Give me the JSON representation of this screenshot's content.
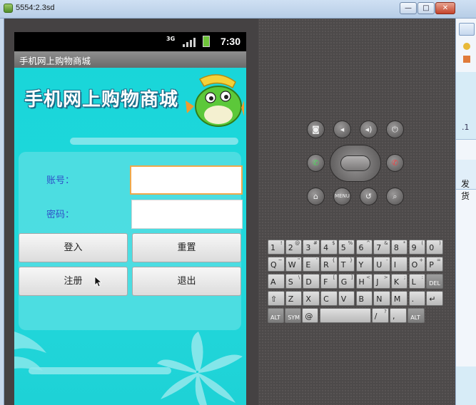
{
  "window": {
    "title": "5554:2.3sd",
    "min_label": "—",
    "max_label": "□",
    "close_label": "✕"
  },
  "status_bar": {
    "network": "3G",
    "time": "7:30"
  },
  "app": {
    "title": "手机网上购物商城",
    "banner_title": "手机网上购物商城",
    "account_label": "账号：",
    "password_label": "密码：",
    "account_value": "",
    "password_value": "",
    "login_button": "登入",
    "reset_button": "重置",
    "register_button": "注册",
    "exit_button": "退出"
  },
  "controls": {
    "menu_label": "MENU"
  },
  "keyboard": {
    "rows": [
      [
        [
          "1",
          "!"
        ],
        [
          "2",
          "@"
        ],
        [
          "3",
          "#"
        ],
        [
          "4",
          "$"
        ],
        [
          "5",
          "%"
        ],
        [
          "6",
          "^"
        ],
        [
          "7",
          "&"
        ],
        [
          "8",
          "*"
        ],
        [
          "9",
          "("
        ],
        [
          "0",
          ")"
        ]
      ],
      [
        [
          "Q",
          "~"
        ],
        [
          "W",
          "\""
        ],
        [
          "E",
          "'"
        ],
        [
          "R",
          "{"
        ],
        [
          "T",
          "}"
        ],
        [
          "Y",
          ""
        ],
        [
          "U",
          "-"
        ],
        [
          "I",
          ""
        ],
        [
          "O",
          "+"
        ],
        [
          "P",
          "="
        ]
      ],
      [
        [
          "A",
          ""
        ],
        [
          "S",
          "\\"
        ],
        [
          "D",
          ""
        ],
        [
          "F",
          "["
        ],
        [
          "G",
          "]"
        ],
        [
          "H",
          "<"
        ],
        [
          "J",
          ">"
        ],
        [
          "K",
          ";"
        ],
        [
          "L",
          ":"
        ],
        [
          "DEL",
          ""
        ]
      ],
      [
        [
          "⇧",
          ""
        ],
        [
          "Z",
          ""
        ],
        [
          "X",
          ""
        ],
        [
          "C",
          ""
        ],
        [
          "V",
          ""
        ],
        [
          "B",
          ""
        ],
        [
          "N",
          ""
        ],
        [
          "M",
          ""
        ],
        [
          ".",
          ""
        ],
        [
          "↵",
          ""
        ]
      ],
      [
        [
          "ALT",
          ""
        ],
        [
          "SYM",
          ""
        ],
        [
          "@",
          ""
        ],
        [
          "",
          ""
        ],
        [
          "/",
          "?"
        ],
        [
          ",",
          ""
        ],
        [
          "ALT",
          ""
        ]
      ]
    ]
  },
  "side_panel": {
    "text_fragment": ".1",
    "text_label": "发货"
  },
  "colors": {
    "app_background": "#1ed6da",
    "label_blue": "#2f4fc8",
    "focus_orange": "#f0a84b",
    "emulator_body": "#4d4a4a"
  }
}
